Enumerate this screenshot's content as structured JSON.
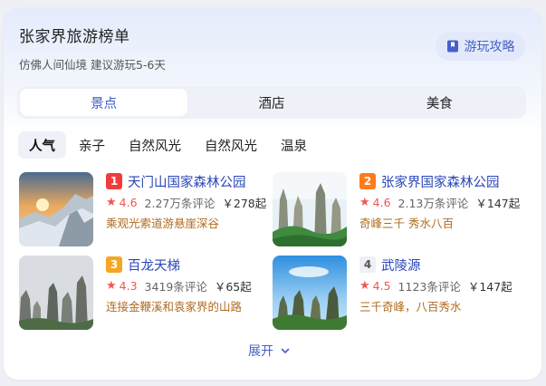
{
  "header": {
    "title": "张家界旅游榜单",
    "subtitle": "仿佛人间仙境  建议游玩5-6天",
    "guide_button": "游玩攻略"
  },
  "tabs": [
    {
      "label": "景点",
      "active": true
    },
    {
      "label": "酒店",
      "active": false
    },
    {
      "label": "美食",
      "active": false
    }
  ],
  "chips": [
    {
      "label": "人气",
      "active": true
    },
    {
      "label": "亲子",
      "active": false
    },
    {
      "label": "自然风光",
      "active": false
    },
    {
      "label": "自然风光",
      "active": false
    },
    {
      "label": "温泉",
      "active": false
    }
  ],
  "attractions": [
    {
      "rank": "1",
      "rank_color": "#f23c3c",
      "name": "天门山国家森林公园",
      "score": "4.6",
      "reviews": "2.27万条评论",
      "price": "￥278起",
      "desc": "乘观光索道游悬崖深谷"
    },
    {
      "rank": "2",
      "rank_color": "#ff7a1a",
      "name": "张家界国家森林公园",
      "score": "4.6",
      "reviews": "2.13万条评论",
      "price": "￥147起",
      "desc": "奇峰三千 秀水八百"
    },
    {
      "rank": "3",
      "rank_color": "#f5a623",
      "name": "百龙天梯",
      "score": "4.3",
      "reviews": "3419条评论",
      "price": "￥65起",
      "desc": "连接金鞭溪和袁家界的山路"
    },
    {
      "rank": "4",
      "rank_color": "#eef0f6",
      "name": "武陵源",
      "score": "4.5",
      "reviews": "1123条评论",
      "price": "￥147起",
      "desc": "三千奇峰，八百秀水"
    }
  ],
  "expand_label": "展开",
  "icons": {
    "guide": "book-icon",
    "rating": "star-icon",
    "expand": "chevron-down-icon"
  },
  "colors": {
    "accent": "#4760c9",
    "link": "#2a46b8",
    "rating": "#f25555",
    "desc": "#b06b20"
  }
}
